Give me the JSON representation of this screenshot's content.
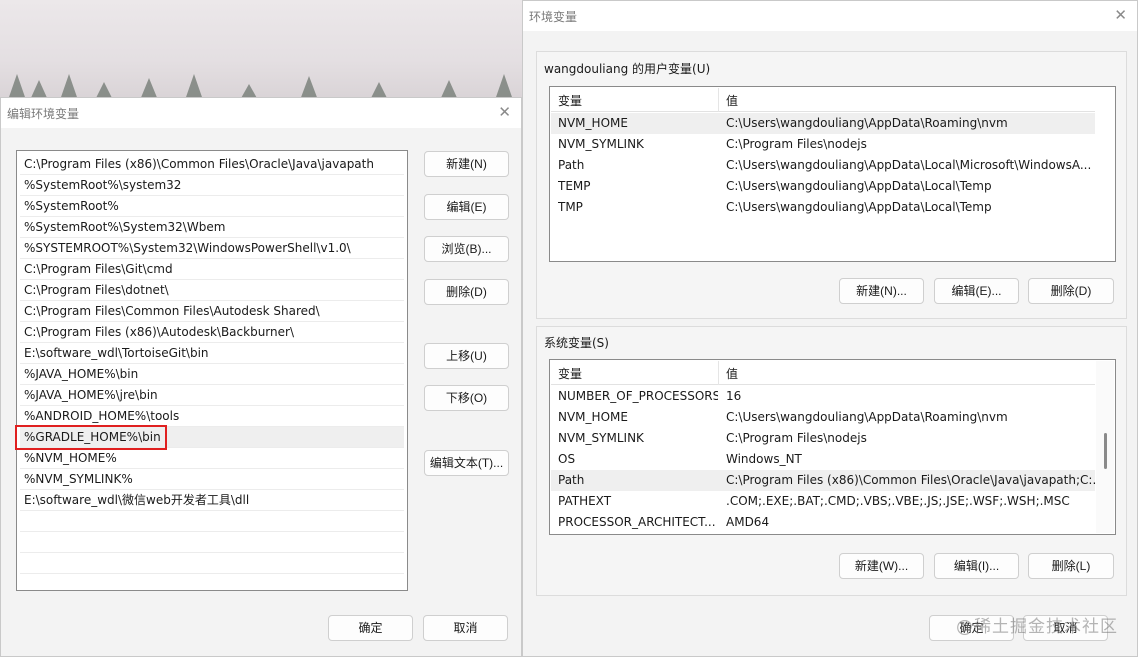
{
  "left_dialog": {
    "title": "编辑环境变量",
    "path_entries": [
      "C:\\Program Files (x86)\\Common Files\\Oracle\\Java\\javapath",
      "%SystemRoot%\\system32",
      "%SystemRoot%",
      "%SystemRoot%\\System32\\Wbem",
      "%SYSTEMROOT%\\System32\\WindowsPowerShell\\v1.0\\",
      "C:\\Program Files\\Git\\cmd",
      "C:\\Program Files\\dotnet\\",
      "C:\\Program Files\\Common Files\\Autodesk Shared\\",
      "C:\\Program Files (x86)\\Autodesk\\Backburner\\",
      "E:\\software_wdl\\TortoiseGit\\bin",
      "%JAVA_HOME%\\bin",
      "%JAVA_HOME%\\jre\\bin",
      "%ANDROID_HOME%\\tools",
      "%GRADLE_HOME%\\bin",
      "%NVM_HOME%",
      "%NVM_SYMLINK%",
      "E:\\software_wdl\\微信web开发者工具\\dll"
    ],
    "selected_index": 13,
    "buttons": {
      "new": "新建(N)",
      "edit": "编辑(E)",
      "browse": "浏览(B)...",
      "delete": "删除(D)",
      "move_up": "上移(U)",
      "move_down": "下移(O)",
      "edit_text": "编辑文本(T)...",
      "ok": "确定",
      "cancel": "取消"
    }
  },
  "right_dialog": {
    "title": "环境变量",
    "user_section": {
      "label": "wangdouliang 的用户变量(U)",
      "headers": [
        "变量",
        "值"
      ],
      "rows": [
        {
          "name": "NVM_HOME",
          "value": "C:\\Users\\wangdouliang\\AppData\\Roaming\\nvm"
        },
        {
          "name": "NVM_SYMLINK",
          "value": "C:\\Program Files\\nodejs"
        },
        {
          "name": "Path",
          "value": "C:\\Users\\wangdouliang\\AppData\\Local\\Microsoft\\WindowsA..."
        },
        {
          "name": "TEMP",
          "value": "C:\\Users\\wangdouliang\\AppData\\Local\\Temp"
        },
        {
          "name": "TMP",
          "value": "C:\\Users\\wangdouliang\\AppData\\Local\\Temp"
        }
      ],
      "selected_index": 0,
      "buttons": {
        "new": "新建(N)...",
        "edit": "编辑(E)...",
        "delete": "删除(D)"
      }
    },
    "system_section": {
      "label": "系统变量(S)",
      "headers": [
        "变量",
        "值"
      ],
      "rows": [
        {
          "name": "NUMBER_OF_PROCESSORS",
          "value": "16"
        },
        {
          "name": "NVM_HOME",
          "value": "C:\\Users\\wangdouliang\\AppData\\Roaming\\nvm"
        },
        {
          "name": "NVM_SYMLINK",
          "value": "C:\\Program Files\\nodejs"
        },
        {
          "name": "OS",
          "value": "Windows_NT"
        },
        {
          "name": "Path",
          "value": "C:\\Program Files (x86)\\Common Files\\Oracle\\Java\\javapath;C:..."
        },
        {
          "name": "PATHEXT",
          "value": ".COM;.EXE;.BAT;.CMD;.VBS;.VBE;.JS;.JSE;.WSF;.WSH;.MSC"
        },
        {
          "name": "PROCESSOR_ARCHITECT...",
          "value": "AMD64"
        }
      ],
      "selected_index": 4,
      "buttons": {
        "new": "新建(W)...",
        "edit": "编辑(I)...",
        "delete": "删除(L)"
      }
    },
    "buttons": {
      "ok": "确定",
      "cancel": "取消"
    }
  },
  "watermark": "@稀土掘金技术社区",
  "colors": {
    "highlight_border": "#e02020",
    "selected_row": "#efefef"
  }
}
